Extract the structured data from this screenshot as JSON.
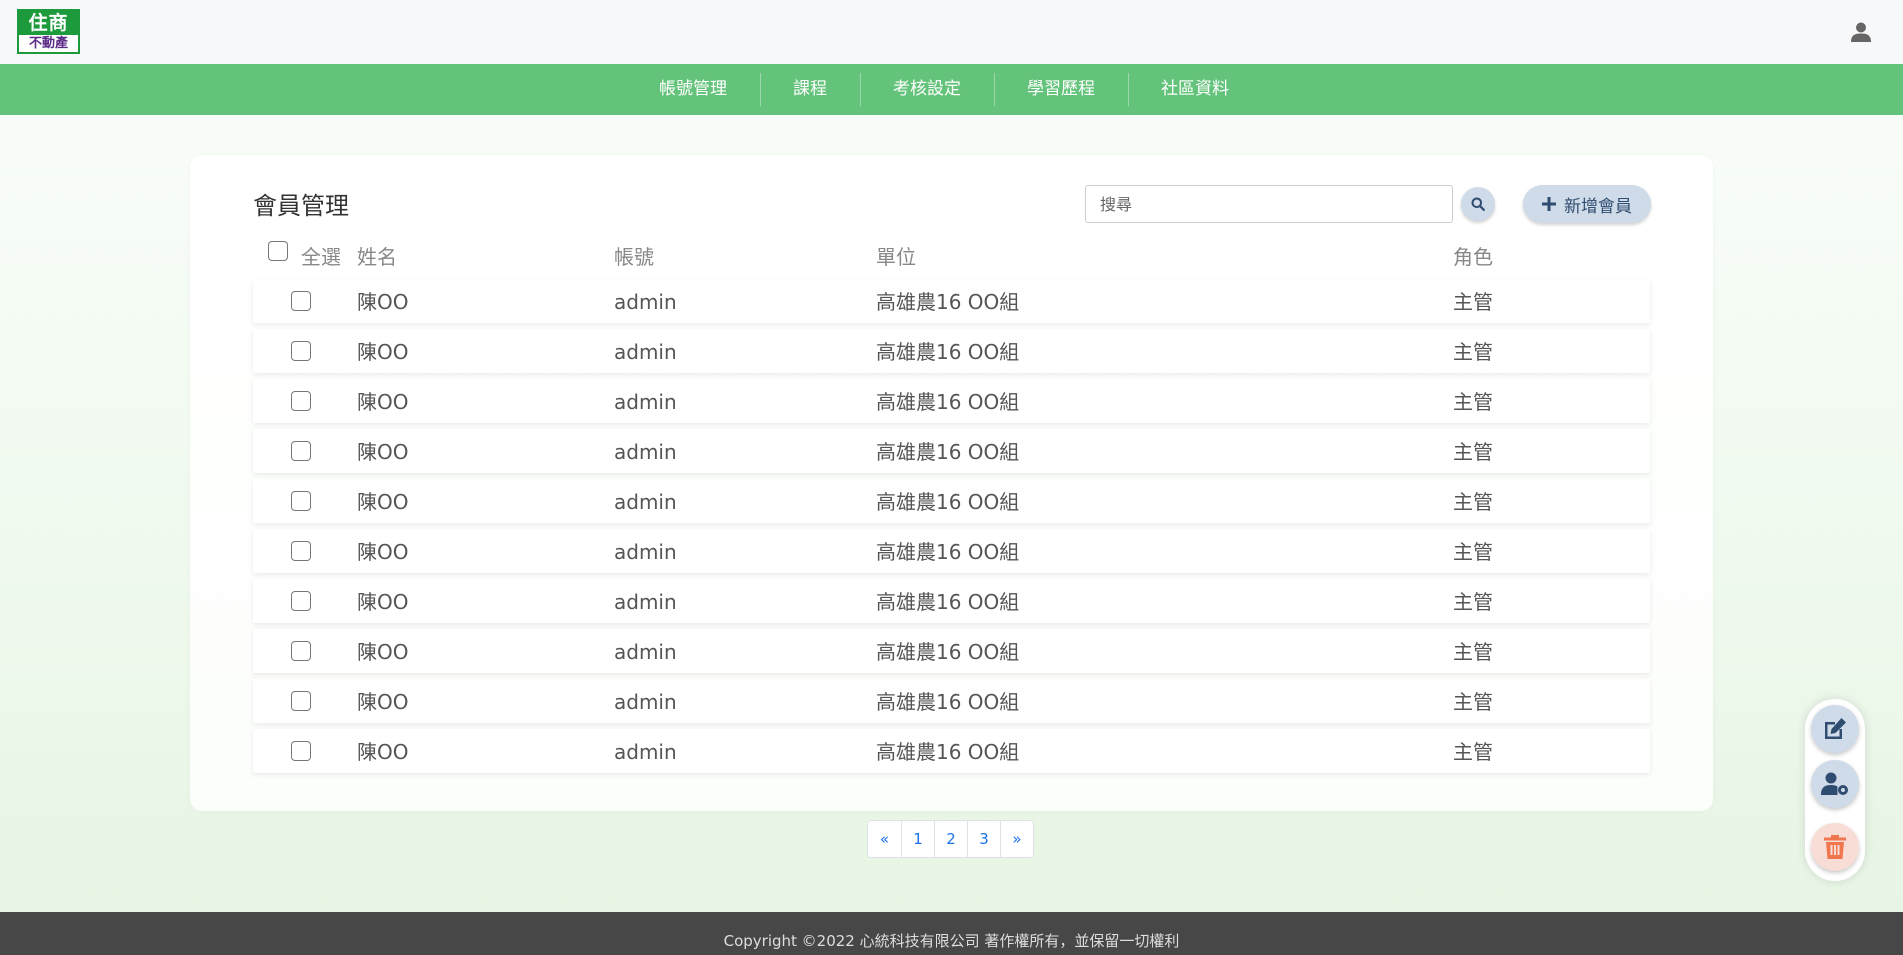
{
  "logo": {
    "line1": "住商",
    "line2": "不動產"
  },
  "nav": [
    "帳號管理",
    "課程",
    "考核設定",
    "學習歷程",
    "社區資料"
  ],
  "page": {
    "title": "會員管理",
    "search_placeholder": "搜尋",
    "add_label": "新增會員"
  },
  "table": {
    "headers": {
      "select_all": "全選",
      "name": "姓名",
      "account": "帳號",
      "unit": "單位",
      "role": "角色"
    },
    "rows": [
      {
        "name": "陳OO",
        "account": "admin",
        "unit": "高雄農16 OO組",
        "role": "主管"
      },
      {
        "name": "陳OO",
        "account": "admin",
        "unit": "高雄農16 OO組",
        "role": "主管"
      },
      {
        "name": "陳OO",
        "account": "admin",
        "unit": "高雄農16 OO組",
        "role": "主管"
      },
      {
        "name": "陳OO",
        "account": "admin",
        "unit": "高雄農16 OO組",
        "role": "主管"
      },
      {
        "name": "陳OO",
        "account": "admin",
        "unit": "高雄農16 OO組",
        "role": "主管"
      },
      {
        "name": "陳OO",
        "account": "admin",
        "unit": "高雄農16 OO組",
        "role": "主管"
      },
      {
        "name": "陳OO",
        "account": "admin",
        "unit": "高雄農16 OO組",
        "role": "主管"
      },
      {
        "name": "陳OO",
        "account": "admin",
        "unit": "高雄農16 OO組",
        "role": "主管"
      },
      {
        "name": "陳OO",
        "account": "admin",
        "unit": "高雄農16 OO組",
        "role": "主管"
      },
      {
        "name": "陳OO",
        "account": "admin",
        "unit": "高雄農16 OO組",
        "role": "主管"
      }
    ]
  },
  "pagination": [
    "«",
    "1",
    "2",
    "3",
    "»"
  ],
  "icons": {
    "user": "user-icon",
    "search": "search-icon",
    "add": "plus-icon",
    "edit": "edit-icon",
    "user_settings": "user-settings-icon",
    "delete": "trash-icon"
  },
  "colors": {
    "nav_bg": "#64c37b",
    "logo_green": "#1d9a3c",
    "button_bg": "#cfdbe8",
    "delete_bg": "#f8ddd6",
    "delete_icon": "#f0764e",
    "footer_bg": "#474747"
  },
  "footer": {
    "copyright": "Copyright ©2022 心統科技有限公司 著作權所有，並保留一切權利"
  }
}
